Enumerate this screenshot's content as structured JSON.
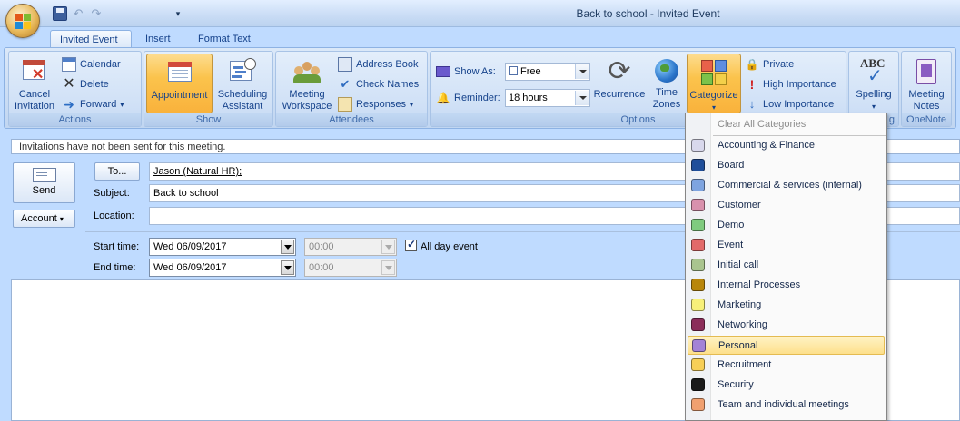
{
  "window": {
    "title": "Back to school  - Invited Event"
  },
  "tabs": [
    {
      "label": "Invited Event",
      "active": true
    },
    {
      "label": "Insert"
    },
    {
      "label": "Format Text"
    }
  ],
  "ribbon": {
    "actions": {
      "label": "Actions",
      "cancel": "Cancel Invitation",
      "calendar": "Calendar",
      "delete": "Delete",
      "forward": "Forward"
    },
    "show": {
      "label": "Show",
      "appointment": "Appointment",
      "scheduling": "Scheduling Assistant"
    },
    "attendees": {
      "label": "Attendees",
      "workspace": "Meeting Workspace",
      "address_book": "Address Book",
      "check_names": "Check Names",
      "responses": "Responses"
    },
    "options": {
      "label": "Options",
      "show_as_label": "Show As:",
      "show_as_value": "Free",
      "reminder_label": "Reminder:",
      "reminder_value": "18 hours",
      "recurrence": "Recurrence",
      "time_zones": "Time Zones",
      "categorize": "Categorize",
      "private": "Private",
      "high_importance": "High Importance",
      "low_importance": "Low Importance"
    },
    "proofing": {
      "label": "g",
      "spelling": "Spelling"
    },
    "onenote": {
      "label": "OneNote",
      "meeting_notes": "Meeting Notes"
    }
  },
  "infobar": {
    "text": "Invitations have not been sent for this meeting."
  },
  "form": {
    "send": "Send",
    "account": "Account",
    "to_button": "To...",
    "to_value": "Jason (Natural HR);",
    "subject_label": "Subject:",
    "subject_value": "Back to school",
    "location_label": "Location:",
    "location_value": "",
    "start_label": "Start time:",
    "start_date": "Wed 06/09/2017",
    "start_time": "00:00",
    "end_label": "End time:",
    "end_date": "Wed 06/09/2017",
    "end_time": "00:00",
    "all_day_label": "All day event",
    "all_day_checked": true
  },
  "categories_menu": {
    "clear": "Clear All Categories",
    "items": [
      {
        "label": "Accounting & Finance",
        "color": "#d8d8ec"
      },
      {
        "label": "Board",
        "color": "#1f4e9a"
      },
      {
        "label": "Commercial & services (internal)",
        "color": "#7ea4e0"
      },
      {
        "label": "Customer",
        "color": "#d891ad"
      },
      {
        "label": "Demo",
        "color": "#7fcb7f"
      },
      {
        "label": "Event",
        "color": "#e26a6a"
      },
      {
        "label": "Initial call",
        "color": "#a9c48f"
      },
      {
        "label": "Internal Processes",
        "color": "#b8860b"
      },
      {
        "label": "Marketing",
        "color": "#f7f07a"
      },
      {
        "label": "Networking",
        "color": "#8b2d5a"
      },
      {
        "label": "Personal",
        "color": "#a383d6"
      },
      {
        "label": "Recruitment",
        "color": "#f7cf57"
      },
      {
        "label": "Security",
        "color": "#1a1a1a"
      },
      {
        "label": "Team and individual meetings",
        "color": "#f0a070"
      }
    ],
    "hover_index": 10
  }
}
